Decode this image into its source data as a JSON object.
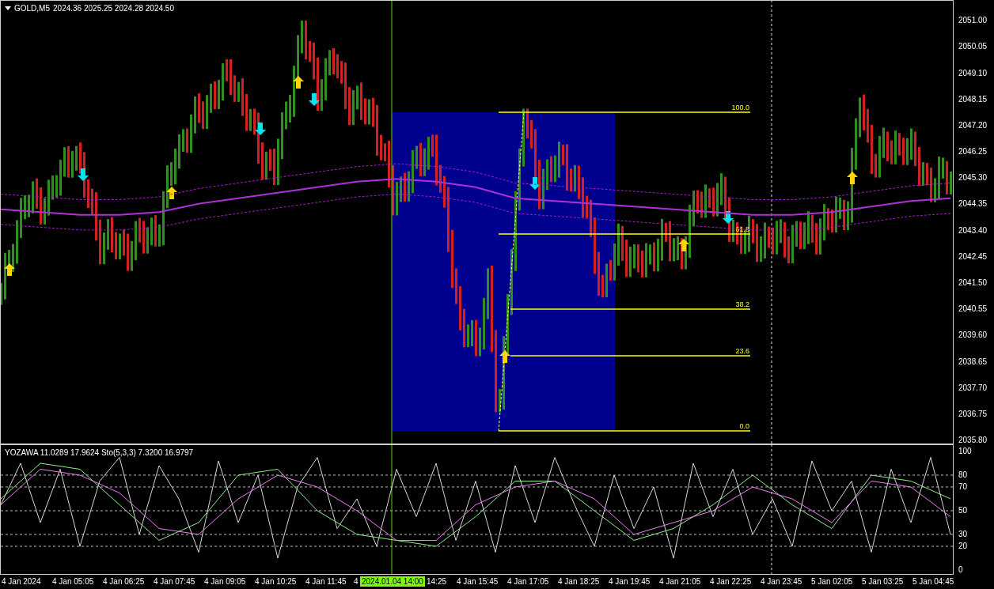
{
  "chart": {
    "symbol": "GOLD,M5",
    "ohlc": [
      "2024.36",
      "2025.25",
      "2024.28",
      "2024.50"
    ]
  },
  "chart_data": {
    "type": "line",
    "ylim": [
      2035.66,
      2051.75
    ],
    "yticks": [
      {
        "value": 2051.0,
        "label": "2051.00"
      },
      {
        "value": 2050.05,
        "label": "2050.05"
      },
      {
        "value": 2049.1,
        "label": "2049.10"
      },
      {
        "value": 2048.15,
        "label": "2048.15"
      },
      {
        "value": 2047.2,
        "label": "2047.20"
      },
      {
        "value": 2046.25,
        "label": "2046.25"
      },
      {
        "value": 2045.3,
        "label": "2045.30"
      },
      {
        "value": 2044.35,
        "label": "2044.35"
      },
      {
        "value": 2043.4,
        "label": "2043.40"
      },
      {
        "value": 2042.45,
        "label": "2042.45"
      },
      {
        "value": 2041.5,
        "label": "2041.50"
      },
      {
        "value": 2040.55,
        "label": "2040.55"
      },
      {
        "value": 2039.6,
        "label": "2039.60"
      },
      {
        "value": 2038.65,
        "label": "2038.65"
      },
      {
        "value": 2037.7,
        "label": "2037.70"
      },
      {
        "value": 2036.75,
        "label": "2036.75"
      },
      {
        "value": 2035.8,
        "label": "2035.80"
      }
    ],
    "series": [
      {
        "color": "#a020c0",
        "line_style": "dashed",
        "values": [
          2044.75,
          2044.65,
          2044.55,
          2044.55,
          2044.65,
          2044.95,
          2045.15,
          2045.35,
          2045.55,
          2045.75,
          2045.85,
          2045.75,
          2045.55,
          2045.15,
          2045.05,
          2044.95,
          2044.85,
          2044.75,
          2044.65,
          2044.55,
          2044.55,
          2044.65,
          2044.85,
          2045.05,
          2045.15
        ]
      },
      {
        "color": "#b030d8",
        "line_style": "solid",
        "values": [
          2044.2,
          2044.1,
          2044.0,
          2044.0,
          2044.1,
          2044.4,
          2044.6,
          2044.8,
          2045.0,
          2045.2,
          2045.3,
          2045.2,
          2045.0,
          2044.6,
          2044.5,
          2044.4,
          2044.3,
          2044.2,
          2044.1,
          2044.0,
          2044.0,
          2044.1,
          2044.3,
          2044.5,
          2044.6
        ]
      },
      {
        "color": "#a020c0",
        "line_style": "dashed",
        "values": [
          2043.65,
          2043.55,
          2043.45,
          2043.45,
          2043.55,
          2043.85,
          2044.05,
          2044.25,
          2044.45,
          2044.65,
          2044.75,
          2044.65,
          2044.45,
          2044.05,
          2043.95,
          2043.85,
          2043.75,
          2043.65,
          2043.55,
          2043.45,
          2043.45,
          2043.55,
          2043.75,
          2043.95,
          2044.05
        ]
      }
    ]
  },
  "fibonacci_levels": [
    "100.0",
    "61.8",
    "38.2",
    "23.6",
    "0.0"
  ],
  "indicator": {
    "header": "YOZAWA 11.0289 17.9624  Sto(5,3,3) 7.3200 16.9797",
    "chart_data": {
      "type": "line",
      "ylim": [
        -4.667,
        105.3
      ],
      "yticks": [
        100,
        80,
        70,
        50,
        30,
        20,
        0
      ],
      "grid": true,
      "series": [
        {
          "color": "#d8d8d8",
          "line_style": "solid",
          "values": [
            55,
            90,
            40,
            85,
            20,
            75,
            95,
            30,
            88,
            60,
            15,
            92,
            40,
            80,
            10,
            70,
            95,
            35,
            60,
            20,
            85,
            45,
            90,
            25,
            75,
            15,
            88,
            40,
            95,
            55,
            20,
            80,
            35,
            70,
            10,
            90,
            45,
            85,
            30,
            60,
            20,
            92,
            50,
            75,
            15,
            85,
            40,
            95,
            30
          ]
        },
        {
          "color": "#90ee90",
          "line_style": "solid",
          "values": [
            60,
            75,
            90,
            87.5,
            85,
            70,
            55,
            40,
            25,
            32.5,
            40,
            60,
            80,
            82.5,
            85,
            67.5,
            50,
            40,
            30,
            27.5,
            25,
            22.5,
            20,
            32.5,
            45,
            60,
            75,
            75,
            75,
            62.5,
            50,
            37.5,
            25,
            30,
            35,
            45,
            55,
            67.5,
            80,
            67.5,
            55,
            45,
            35,
            57.5,
            80,
            77.5,
            75,
            67.5,
            60
          ]
        },
        {
          "color": "#ee82ee",
          "line_style": "solid",
          "values": [
            55,
            70,
            85,
            82.5,
            80,
            72.5,
            65,
            50,
            35,
            32.5,
            30,
            45,
            60,
            70,
            80,
            75,
            70,
            60,
            50,
            37.5,
            25,
            25,
            25,
            40,
            55,
            62.5,
            70,
            72.5,
            75,
            67.5,
            60,
            45,
            30,
            35,
            40,
            45,
            50,
            60,
            70,
            65,
            60,
            50,
            40,
            57.5,
            75,
            72.5,
            70,
            57.5,
            45
          ]
        }
      ]
    }
  },
  "time_axis": {
    "labels": [
      "4 Jan 2024",
      "4 Jan 05:05",
      "4 Jan 06:25",
      "4 Jan 07:45",
      "4 Jan 09:05",
      "4 Jan 10:25",
      "4 Jan 11:45",
      "4",
      "14:25",
      "4 Jan 15:45",
      "4 Jan 17:05",
      "4 Jan 18:25",
      "4 Jan 19:45",
      "4 Jan 21:05",
      "4 Jan 22:25",
      "4 Jan 23:45",
      "5 Jan 02:05",
      "5 Jan 03:25",
      "5 Jan 04:45"
    ],
    "crosshair_label": "2024.01.04 14:00"
  }
}
